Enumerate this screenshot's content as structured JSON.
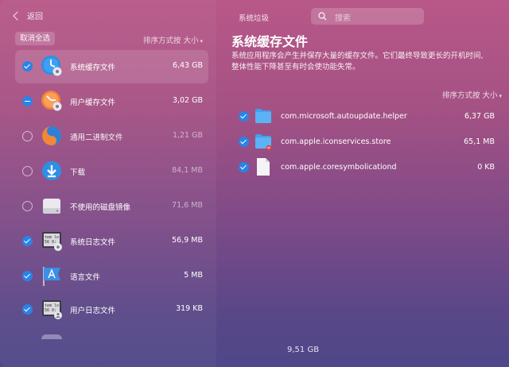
{
  "nav": {
    "back_label": "返回",
    "section_title": "系统垃圾"
  },
  "search": {
    "placeholder": "搜索"
  },
  "left_panel": {
    "deselect_label": "取消全选",
    "sort_label": "排序方式按 大小",
    "items": [
      {
        "label": "系统缓存文件",
        "size": "6,43 GB",
        "state": "checked",
        "icon": "system-cache-icon",
        "selected": true
      },
      {
        "label": "用户缓存文件",
        "size": "3,02 GB",
        "state": "partial",
        "icon": "user-cache-icon"
      },
      {
        "label": "通用二进制文件",
        "size": "1,21 GB",
        "state": "unchecked",
        "icon": "universal-binary-icon"
      },
      {
        "label": "下载",
        "size": "84,1 MB",
        "state": "unchecked",
        "icon": "downloads-icon"
      },
      {
        "label": "不使用的磁盘镜像",
        "size": "71,6 MB",
        "state": "unchecked",
        "icon": "disk-image-icon"
      },
      {
        "label": "系统日志文件",
        "size": "56,9 MB",
        "state": "checked",
        "icon": "system-log-icon"
      },
      {
        "label": "语言文件",
        "size": "5 MB",
        "state": "checked",
        "icon": "language-files-icon"
      },
      {
        "label": "用户日志文件",
        "size": "319 KB",
        "state": "checked",
        "icon": "user-log-icon"
      }
    ]
  },
  "detail": {
    "title": "系统缓存文件",
    "description_line1": "系统应用程序会产生并保存大量的缓存文件。它们最终导致更长的开机时间,",
    "description_line2": "整体性能下降甚至有时会使功能失常。",
    "sort_label": "排序方式按 大小",
    "files": [
      {
        "name": "com.microsoft.autoupdate.helper",
        "size": "6,37 GB",
        "icon": "folder-icon"
      },
      {
        "name": "com.apple.iconservices.store",
        "size": "65,1 MB",
        "icon": "folder-locked-icon"
      },
      {
        "name": "com.apple.coresymbolicationd",
        "size": "0 KB",
        "icon": "document-icon"
      }
    ]
  },
  "footer": {
    "total": "9,51 GB"
  },
  "colors": {
    "accent": "#2a83e6",
    "bg_top": "#b85888",
    "bg_bottom": "#4e4789"
  }
}
